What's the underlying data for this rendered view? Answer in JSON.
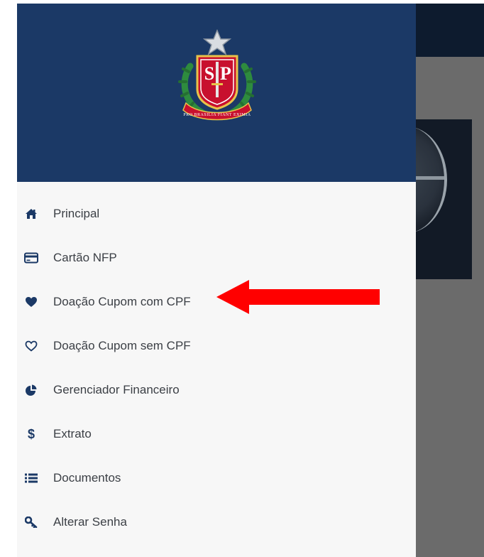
{
  "app": {
    "logo_icon": "sao-paulo-coat-of-arms",
    "logo_text": "SP",
    "logo_motto": "PRO BRASILIA FIANT EXIMIA"
  },
  "colors": {
    "header": "#1b3966",
    "drawer": "#f7f7f7",
    "icon": "#1b3966",
    "label": "#3b3f45",
    "arrow": "#ff0000"
  },
  "menu": {
    "items": [
      {
        "label": "Principal",
        "icon": "home-icon"
      },
      {
        "label": "Cartão NFP",
        "icon": "credit-card-icon"
      },
      {
        "label": "Doação Cupom com CPF",
        "icon": "heart-filled-icon"
      },
      {
        "label": "Doação Cupom sem CPF",
        "icon": "heart-outline-icon"
      },
      {
        "label": "Gerenciador Financeiro",
        "icon": "pie-chart-icon"
      },
      {
        "label": "Extrato",
        "icon": "dollar-icon"
      },
      {
        "label": "Documentos",
        "icon": "list-icon"
      },
      {
        "label": "Alterar Senha",
        "icon": "key-icon"
      }
    ]
  },
  "annotation": {
    "arrow_icon": "red-arrow-left-icon",
    "points_to": "Doação Cupom com CPF"
  }
}
